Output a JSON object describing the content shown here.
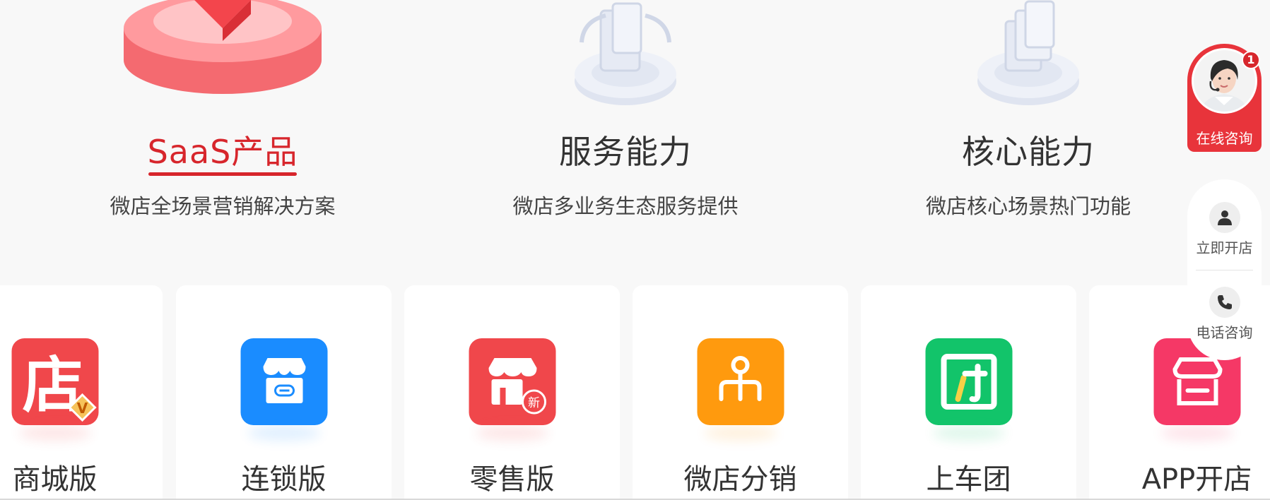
{
  "tabs": [
    {
      "title": "SaaS产品",
      "subtitle": "微店全场景营销解决方案",
      "active": true
    },
    {
      "title": "服务能力",
      "subtitle": "微店多业务生态服务提供",
      "active": false
    },
    {
      "title": "核心能力",
      "subtitle": "微店核心场景热门功能",
      "active": false
    }
  ],
  "products": [
    {
      "label": "商城版",
      "icon": "store-vip-icon",
      "color": "#f0474b",
      "icon_text": "店",
      "badge_text": "V"
    },
    {
      "label": "连锁版",
      "icon": "chain-store-icon",
      "color": "#1a8cff"
    },
    {
      "label": "零售版",
      "icon": "retail-store-icon",
      "color": "#f0474b",
      "badge_text": "新"
    },
    {
      "label": "微店分销",
      "icon": "distribution-icon",
      "color": "#ff9a0e"
    },
    {
      "label": "上车团",
      "icon": "group-buy-icon",
      "color": "#12c46a"
    },
    {
      "label": "APP开店",
      "icon": "app-store-icon",
      "color": "#f53866"
    }
  ],
  "widget": {
    "consult_label": "在线咨询",
    "badge_count": "1",
    "open_store_label": "立即开店",
    "phone_label": "电话咨询"
  }
}
